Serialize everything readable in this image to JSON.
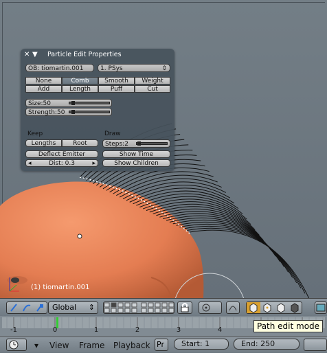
{
  "panel": {
    "title": "Particle Edit Properties",
    "object_field": "OB: tiomartin.001",
    "psys_field": "1. PSys",
    "brush_row1": [
      "None",
      "Comb",
      "Smooth",
      "Weight"
    ],
    "brush_row2": [
      "Add",
      "Length",
      "Puff",
      "Cut"
    ],
    "selected_brush": "Comb",
    "size_label": "Size:50",
    "size_value": 50,
    "strength_label": "Strength:50",
    "strength_value": 50,
    "keep_label": "Keep",
    "keep_buttons": [
      "Lengths",
      "Root"
    ],
    "deflect_label": "Deflect Emitter",
    "dist_label": "Dist: 0.3",
    "draw_label": "Draw",
    "steps_label": "Steps:2",
    "steps_value": 2,
    "show_time": "Show Time",
    "show_children": "Show Children"
  },
  "viewport": {
    "object_name": "(1) tiomartin.001"
  },
  "header": {
    "orientation": "Global"
  },
  "timeline": {
    "ticks": [
      "-1",
      "0",
      "1",
      "2",
      "3",
      "4"
    ],
    "current_frame": 0
  },
  "tooltip": "Path edit mode",
  "footer": {
    "menus": [
      "View",
      "Frame",
      "Playback"
    ],
    "pr_label": "Pr",
    "start_label": "Start: 1",
    "end_label": "End: 250"
  },
  "colors": {
    "background": "#6d7880",
    "head": "#e7845b",
    "panel": "#46525c",
    "tooltip": "#ffffe0"
  }
}
